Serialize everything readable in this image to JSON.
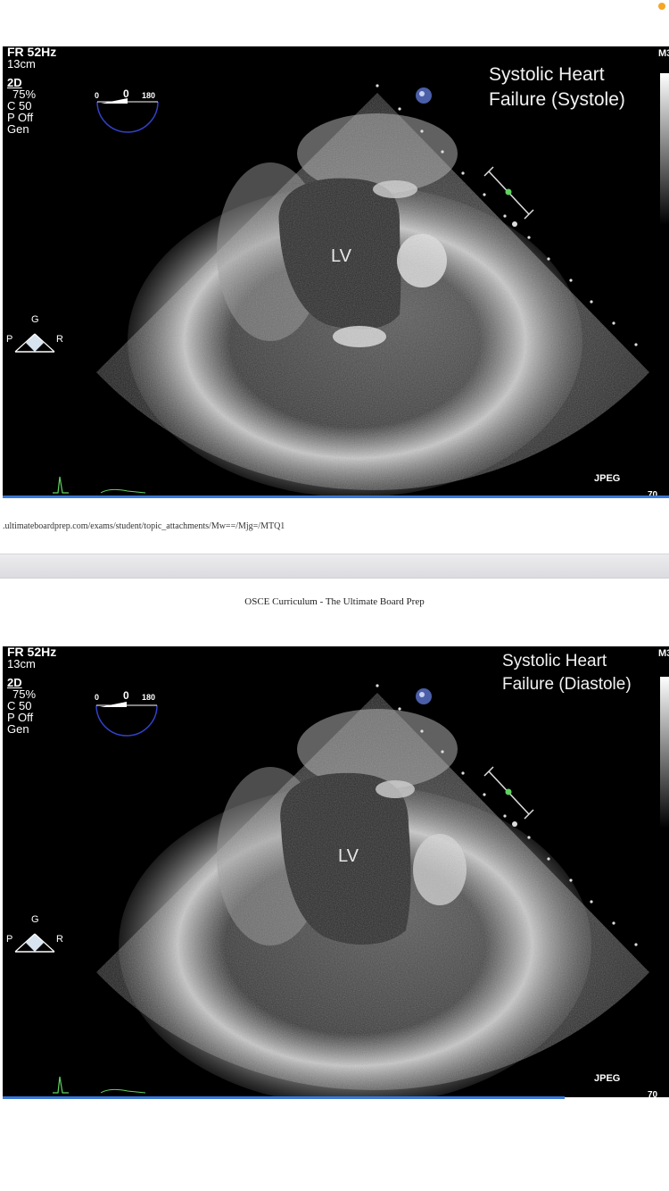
{
  "top_panel": {
    "params": {
      "fr": "FR 52Hz",
      "depth": "13cm",
      "mode": "2D",
      "gain": "75%",
      "comp": "C 50",
      "power": "P Off",
      "freq": "Gen"
    },
    "caption": [
      "Systolic Heart",
      "Failure (Systole)"
    ],
    "lv_label": "LV",
    "jpeg_label": "JPEG",
    "angle": {
      "min": "0",
      "value": "0",
      "max": "180"
    },
    "orientation": {
      "top": "G",
      "left": "P",
      "right": "R"
    },
    "m_label": "M3",
    "corner_num": "70"
  },
  "url_text": ".ultimateboardprep.com/exams/student/topic_attachments/Mw==/Mjg=/MTQ1",
  "page_header": "OSCE Curriculum - The Ultimate Board Prep",
  "bottom_panel": {
    "params": {
      "fr": "FR 52Hz",
      "depth": "13cm",
      "mode": "2D",
      "gain": "75%",
      "comp": "C 50",
      "power": "P Off",
      "freq": "Gen"
    },
    "caption": [
      "Systolic Heart",
      "Failure (Diastole)"
    ],
    "lv_label": "LV",
    "jpeg_label": "JPEG",
    "angle": {
      "min": "0",
      "value": "0",
      "max": "180"
    },
    "orientation": {
      "top": "G",
      "left": "P",
      "right": "R"
    },
    "m_label": "M3",
    "corner_num": "70"
  },
  "colors": {
    "status_dot": "#f5a623",
    "accent_blue": "#3a78d8",
    "ecg_green": "#5fd35f"
  }
}
